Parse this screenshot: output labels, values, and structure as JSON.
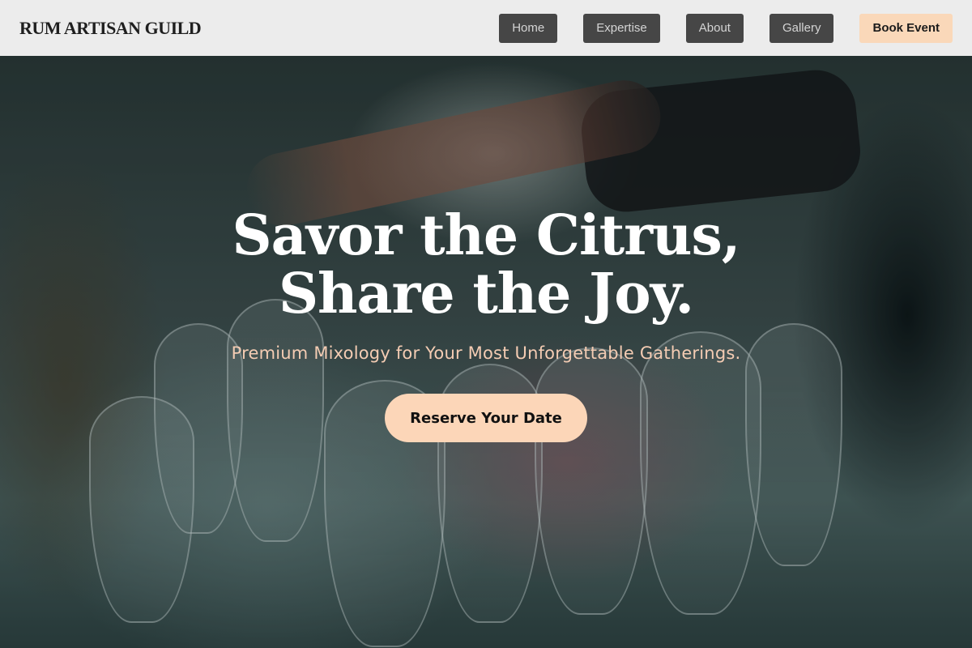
{
  "brand": {
    "name": "RUM ARTISAN GUILD"
  },
  "nav": {
    "items": [
      {
        "label": "Home"
      },
      {
        "label": "Expertise"
      },
      {
        "label": "About"
      },
      {
        "label": "Gallery"
      }
    ],
    "cta_label": "Book Event"
  },
  "hero": {
    "headline_line1": "Savor the Citrus,",
    "headline_line2": "Share the Joy.",
    "subtitle": "Premium Mixology for Your Most Unforgettable Gatherings.",
    "cta_label": "Reserve Your Date",
    "background_image": "bartender-glassware-photo"
  },
  "colors": {
    "header_bg": "#ececec",
    "nav_button_bg": "#464646",
    "accent_peach": "#fcd6b8",
    "subtitle_color": "#f4ccb3"
  }
}
